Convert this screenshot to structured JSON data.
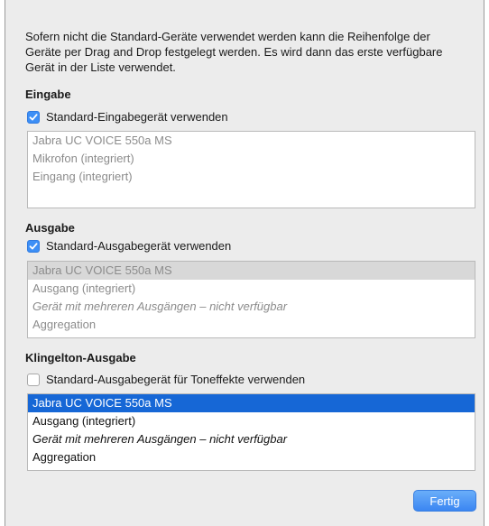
{
  "intro_text": "Sofern nicht die Standard-Geräte verwendet werden kann die Reihenfolge der Geräte per Drag and Drop festgelegt werden. Es wird dann das erste verfügbare Gerät in der Liste verwendet.",
  "sections": {
    "input": {
      "title": "Eingabe",
      "checkbox_label": "Standard-Eingabegerät verwenden",
      "checked": true,
      "devices": [
        "Jabra UC VOICE 550a MS",
        "Mikrofon (integriert)",
        "Eingang (integriert)"
      ]
    },
    "output": {
      "title": "Ausgabe",
      "checkbox_label": "Standard-Ausgabegerät verwenden",
      "checked": true,
      "devices": [
        "Jabra UC VOICE 550a MS",
        "Ausgang (integriert)",
        "Gerät mit mehreren Ausgängen – nicht verfügbar",
        "Aggregation"
      ]
    },
    "ringtone": {
      "title": "Klingelton-Ausgabe",
      "checkbox_label": "Standard-Ausgabegerät für Toneffekte verwenden",
      "checked": false,
      "devices": [
        "Jabra UC VOICE 550a MS",
        "Ausgang (integriert)",
        "Gerät mit mehreren Ausgängen – nicht verfügbar",
        "Aggregation"
      ]
    }
  },
  "buttons": {
    "done_label": "Fertig"
  },
  "colors": {
    "selection_active": "#1667d6",
    "selection_inactive": "#d8d8d8",
    "checkbox_checked": "#3d8ff6",
    "button_primary": "#3b86f2"
  },
  "icons": {
    "checkmark": "checkmark-icon"
  }
}
